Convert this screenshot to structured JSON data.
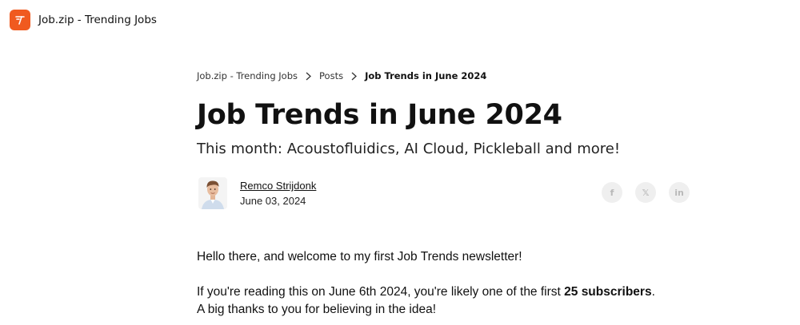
{
  "header": {
    "site_name": "Job.zip - Trending Jobs",
    "logo_icon": "job-zip-logo-icon",
    "brand_color": "#f05a1f"
  },
  "breadcrumb": {
    "items": [
      "Job.zip - Trending Jobs",
      "Posts"
    ],
    "current": "Job Trends in June 2024"
  },
  "article": {
    "title": "Job Trends in June 2024",
    "subtitle": "This month: Acoustofluidics, AI Cloud, Pickleball and more!",
    "author": {
      "name": "Remco Strijdonk",
      "date": "June 03, 2024"
    },
    "share": {
      "facebook": "f",
      "x": "𝕏",
      "linkedin": "in"
    },
    "paragraphs": {
      "p1": "Hello there, and welcome to my first Job Trends newsletter!",
      "p2_before": "If you're reading this on June 6th 2024, you're likely one of the first ",
      "p2_bold": "25 subscribers",
      "p2_after": ".",
      "p3": "A big thanks to you for believing in the idea!"
    }
  }
}
